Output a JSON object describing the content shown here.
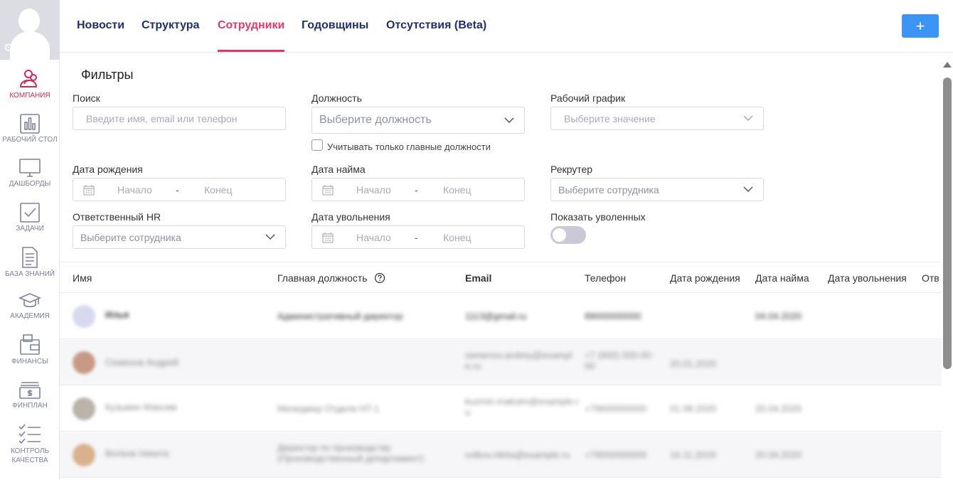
{
  "sidebar": {
    "items": [
      {
        "label": "КОМПАНИЯ",
        "icon": "company-icon",
        "active": true
      },
      {
        "label": "РАБОЧИЙ СТОЛ",
        "icon": "desktop-chart-icon"
      },
      {
        "label": "ДАШБОРДЫ",
        "icon": "monitor-icon"
      },
      {
        "label": "ЗАДАЧИ",
        "icon": "checkbox-icon"
      },
      {
        "label": "БАЗА ЗНАНИЙ",
        "icon": "document-icon"
      },
      {
        "label": "АКАДЕМИЯ",
        "icon": "graduation-cap-icon"
      },
      {
        "label": "ФИНАНСЫ",
        "icon": "wallet-icon"
      },
      {
        "label": "ФИНПЛАН",
        "icon": "money-stack-icon"
      },
      {
        "label": "КОНТРОЛЬ КАЧЕСТВА",
        "icon": "checklist-icon"
      }
    ]
  },
  "tabs": [
    {
      "label": "Новости"
    },
    {
      "label": "Структура"
    },
    {
      "label": "Сотрудники",
      "active": true
    },
    {
      "label": "Годовщины"
    },
    {
      "label": "Отсутствия (Beta)"
    }
  ],
  "add_button": {
    "label": "+"
  },
  "filters": {
    "title": "Фильтры",
    "search": {
      "label": "Поиск",
      "placeholder": "Введите имя, email или телефон"
    },
    "position": {
      "label": "Должность",
      "placeholder": "Выберите должность",
      "checkbox_label": "Учитывать только главные должности"
    },
    "schedule": {
      "label": "Рабочий график",
      "placeholder": "Выберите значение"
    },
    "birth_date": {
      "label": "Дата рождения",
      "start": "Начало",
      "dash": "-",
      "end": "Конец"
    },
    "hire_date": {
      "label": "Дата найма",
      "start": "Начало",
      "dash": "-",
      "end": "Конец"
    },
    "recruiter": {
      "label": "Рекрутер",
      "placeholder": "Выберите сотрудника"
    },
    "responsible_hr": {
      "label": "Ответственный HR",
      "placeholder": "Выберите сотрудника"
    },
    "dismissal_date": {
      "label": "Дата увольнения",
      "start": "Начало",
      "dash": "-",
      "end": "Конец"
    },
    "show_dismissed": {
      "label": "Показать уволенных"
    }
  },
  "table": {
    "columns": [
      "Имя",
      "Главная должность",
      "Email",
      "Телефон",
      "Дата рождения",
      "Дата найма",
      "Дата увольнения",
      "Отв"
    ],
    "rows": [
      {
        "name": "Илья",
        "position": "Административный директор",
        "email": "1113@gmail.ru",
        "phone": "89000000000",
        "birth": "",
        "hire": "04.04.2020"
      },
      {
        "name": "Семенов Андрей",
        "position": "",
        "email": "semenov.andrey@example.ru",
        "phone": "+7 (900) 000-00-00",
        "birth": "20.01.2020",
        "hire": ""
      },
      {
        "name": "Кузьмин Максим",
        "position": "Менеджер Отдела HT-1",
        "email": "kuzmin.maksim@example.ru",
        "phone": "+79000000000",
        "birth": "01.08.2020",
        "hire": "20.04.2020"
      },
      {
        "name": "Волков Никита",
        "position": "Директор по производству (Производственный департамент)",
        "email": "volkov.nikita@example.ru",
        "phone": "+79000000000",
        "birth": "16.11.2019",
        "hire": "20.04.2020"
      }
    ]
  }
}
